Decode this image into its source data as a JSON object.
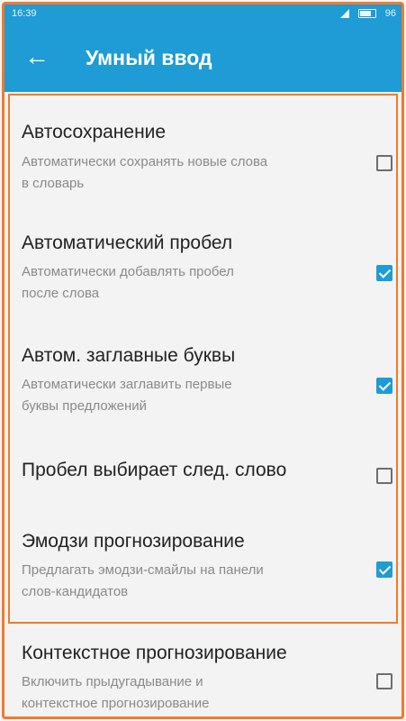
{
  "status_bar": {
    "time": "16:39",
    "battery_label": "96"
  },
  "toolbar": {
    "back_icon": "arrow-left-icon",
    "title": "Умный ввод"
  },
  "colors": {
    "toolbar": "#1f9bd6",
    "accent": "#1f9bd6",
    "highlight_border": "#f07a2e"
  },
  "settings": [
    {
      "title": "Автосохранение",
      "subtitle_1": "Автоматически сохранять новые слова",
      "subtitle_2": "в словарь",
      "checked": false
    },
    {
      "title": "Автоматический пробел",
      "subtitle_1": "Автоматически добавлять пробел",
      "subtitle_2": "после слова",
      "checked": true
    },
    {
      "title": "Автом. заглавные буквы",
      "subtitle_1": "Автоматически заглавить первые",
      "subtitle_2": "буквы предложений",
      "checked": true
    },
    {
      "title": "Пробел выбирает след. слово",
      "subtitle_1": "",
      "subtitle_2": "",
      "checked": false
    },
    {
      "title": "Эмодзи прогнозирование",
      "subtitle_1": "Предлагать эмодзи-смайлы на панели",
      "subtitle_2": "слов-кандидатов",
      "checked": true
    },
    {
      "title": "Контекстное прогнозирование",
      "subtitle_1": "Включить прыдугадывание и",
      "subtitle_2": "контекстное прогнозирование",
      "checked": false
    }
  ]
}
